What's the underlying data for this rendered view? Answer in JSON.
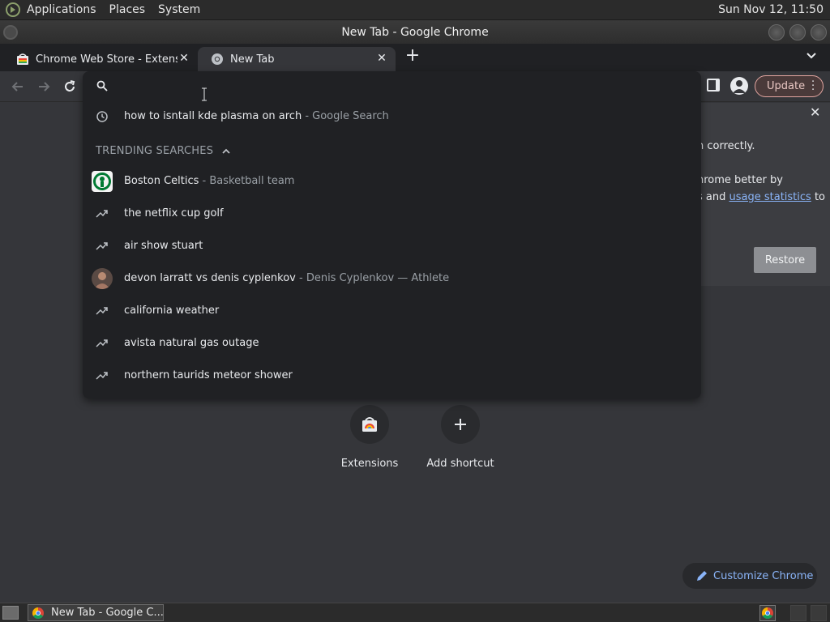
{
  "panel": {
    "menus": [
      "Applications",
      "Places",
      "System"
    ],
    "clock": "Sun Nov 12, 11:50"
  },
  "window": {
    "title": "New Tab - Google Chrome"
  },
  "tabs": [
    {
      "label": "Chrome Web Store - Extensions",
      "active": false,
      "icon": "chrome-web-store-icon"
    },
    {
      "label": "New Tab",
      "active": true,
      "icon": "chrome-icon"
    }
  ],
  "toolbar": {
    "update_label": "Update"
  },
  "omnibox": {
    "query": "",
    "history": [
      {
        "text": "how to isntall kde plasma on arch",
        "sub": " - Google Search",
        "icon": "history-clock-icon"
      }
    ],
    "trending_header": "TRENDING SEARCHES",
    "trending": [
      {
        "text": "Boston Celtics",
        "sub": " - Basketball team",
        "icon": "celtics-logo"
      },
      {
        "text": "the netflix cup golf",
        "sub": "",
        "icon": "trending-icon"
      },
      {
        "text": "air show stuart",
        "sub": "",
        "icon": "trending-icon"
      },
      {
        "text": "devon larratt vs denis cyplenkov",
        "sub": " - Denis Cyplenkov — Athlete",
        "icon": "athlete-photo"
      },
      {
        "text": "california weather",
        "sub": "",
        "icon": "trending-icon"
      },
      {
        "text": "avista natural gas outage",
        "sub": "",
        "icon": "trending-icon"
      },
      {
        "text": "northern taurids meteor shower",
        "sub": "",
        "icon": "trending-icon"
      }
    ]
  },
  "infobar": {
    "line1": "n correctly.",
    "line2": "hrome better by",
    "line3_prefix": "s and ",
    "line3_link": "usage statistics",
    "line3_suffix": " to",
    "restore_label": "Restore"
  },
  "shortcuts": [
    {
      "label": "Extensions",
      "icon": "chrome-web-store-icon"
    },
    {
      "label": "Add shortcut",
      "icon": "plus-icon"
    }
  ],
  "customize_label": "Customize Chrome",
  "taskbar": {
    "task_label": "New Tab - Google C..."
  },
  "colors": {
    "accent_link": "#8ab4f8",
    "dropdown_bg": "#202124",
    "page_bg": "#35363a"
  }
}
